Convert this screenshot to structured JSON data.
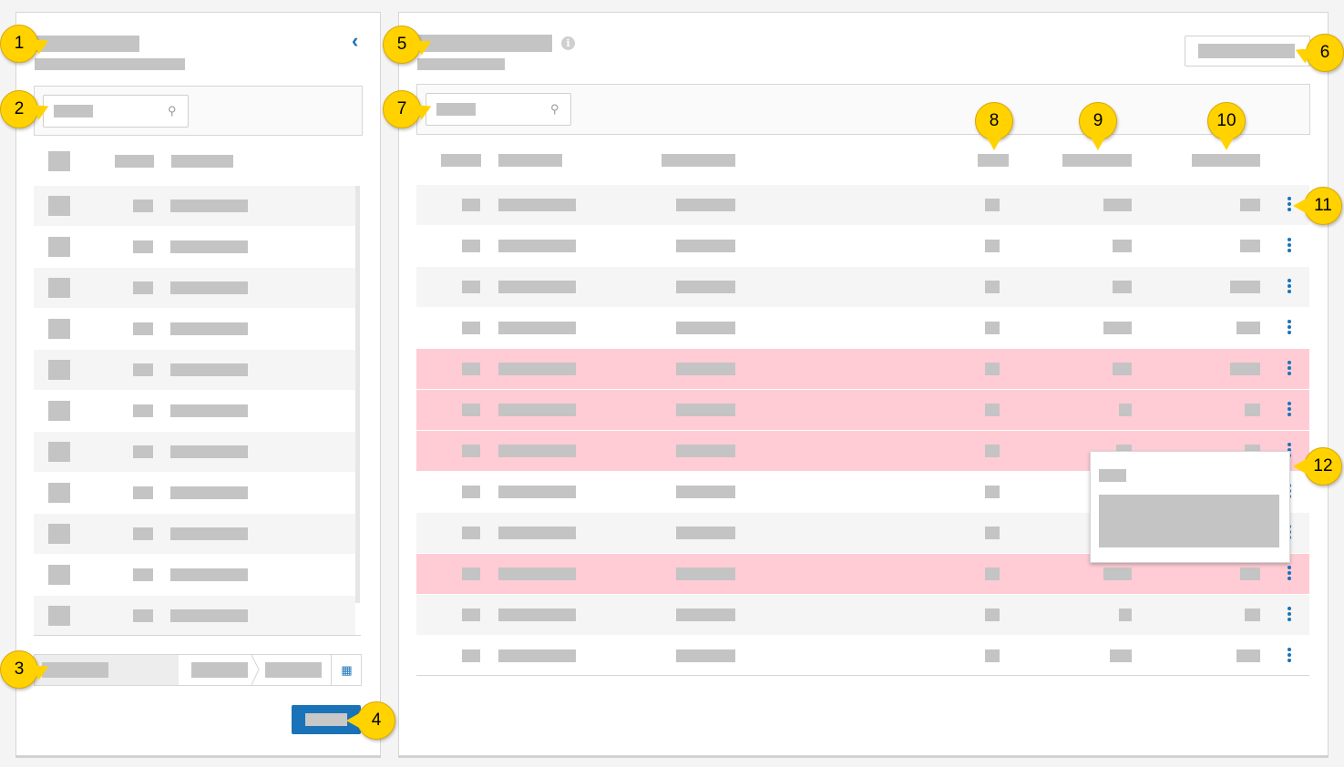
{
  "colors": {
    "accent": "#1a73b8",
    "flagged_row": "#ffccd5",
    "callout": "#ffd200",
    "placeholder_block": "#c4c4c4"
  },
  "icons": {
    "collapse": "chevron-left-icon",
    "search": "search-icon",
    "info": "info-icon",
    "calendar": "calendar-icon",
    "row_menu": "more-vertical-icon"
  },
  "left_panel": {
    "collapse_glyph": "‹",
    "search_glyph": "⚲",
    "calendar_glyph": "▦",
    "row_count": 11
  },
  "right_panel": {
    "info_glyph": "i",
    "search_glyph": "⚲",
    "row_count": 12,
    "flagged_rows": [
      4,
      5,
      6,
      9
    ],
    "open_menu_row": 6
  },
  "callouts": [
    "1",
    "2",
    "3",
    "4",
    "5",
    "6",
    "7",
    "8",
    "9",
    "10",
    "11",
    "12"
  ]
}
